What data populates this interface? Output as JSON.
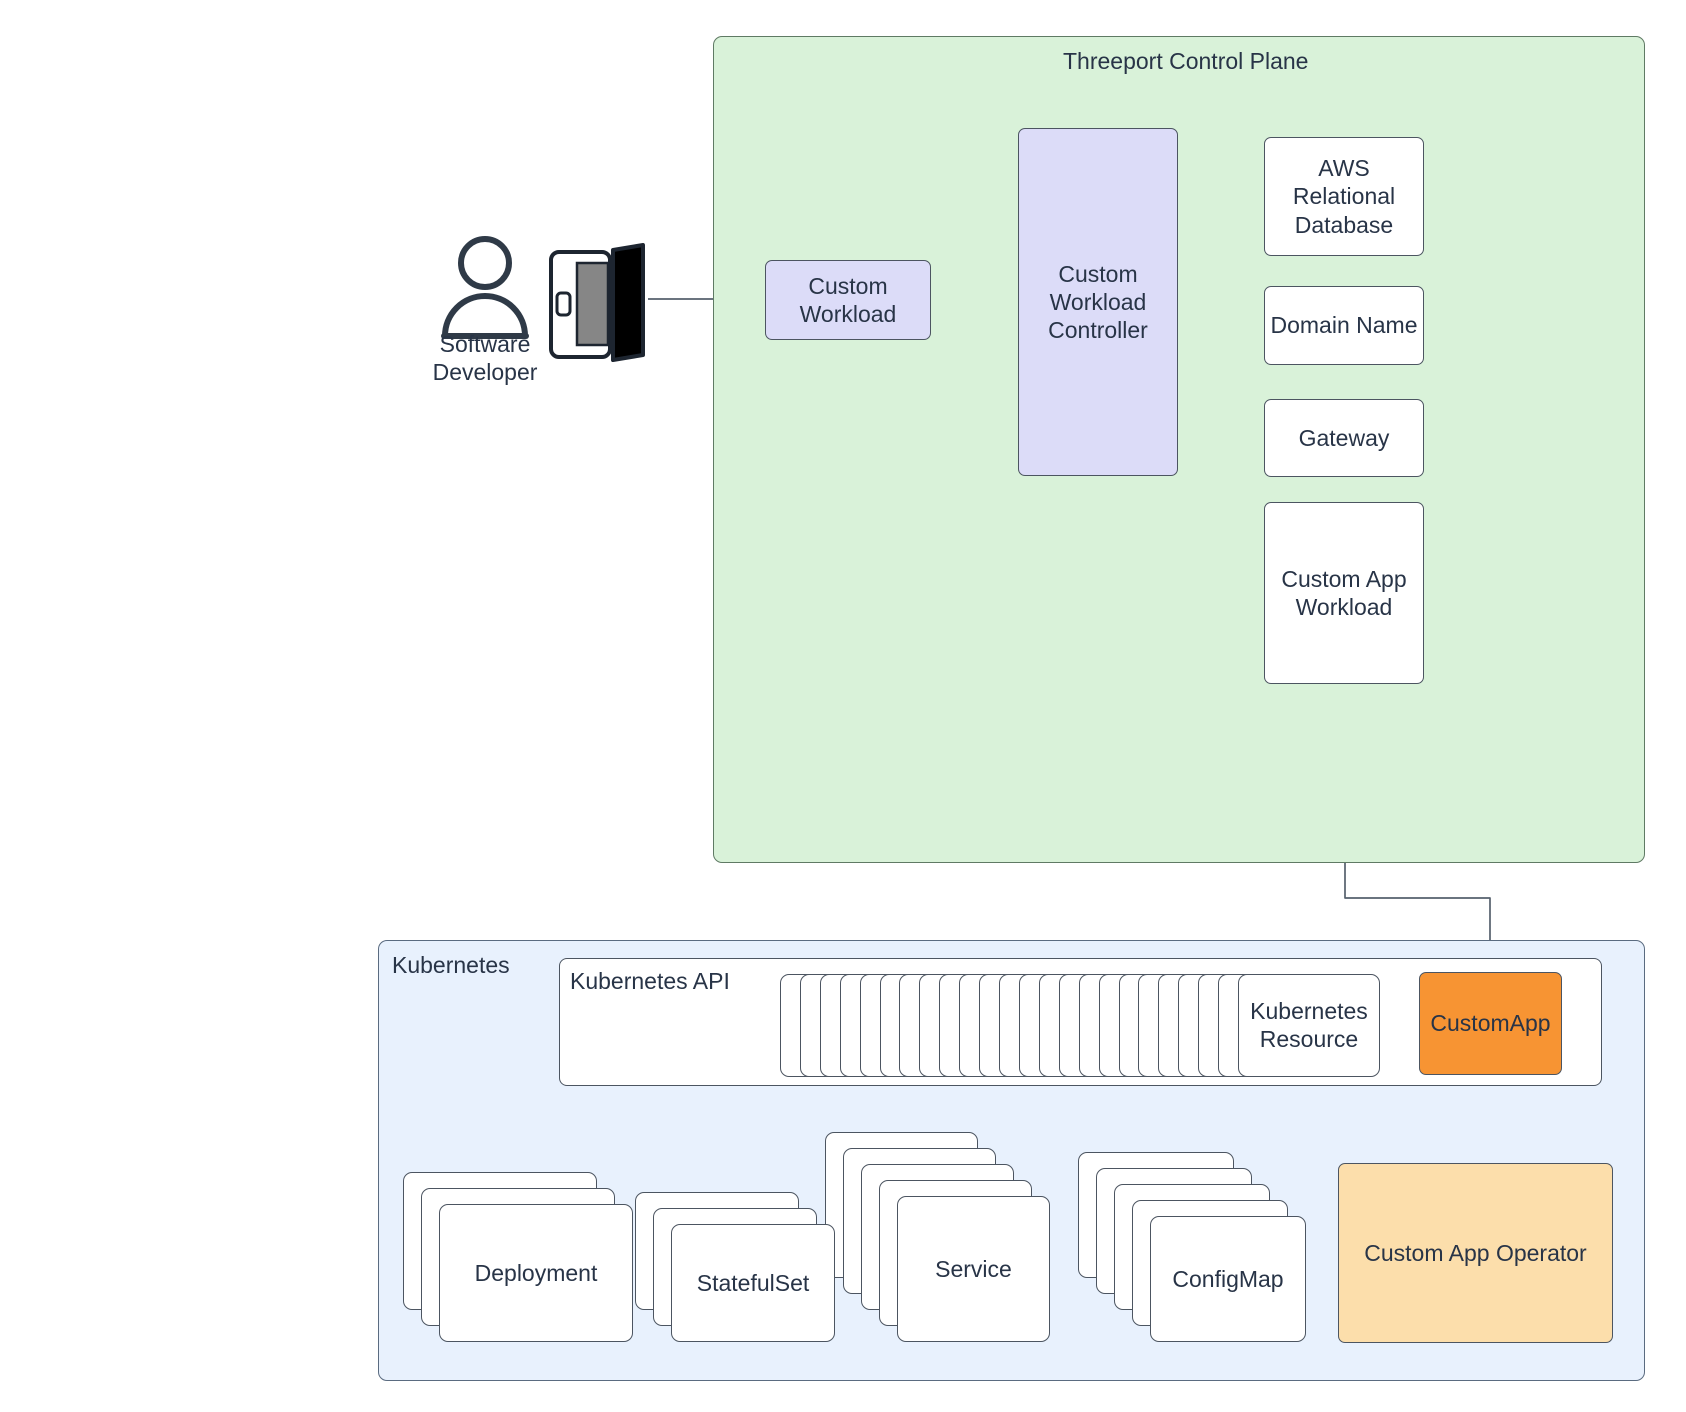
{
  "diagram": {
    "title_control_plane": "Threeport Control Plane",
    "title_kubernetes": "Kubernetes",
    "title_kubernetes_api": "Kubernetes API"
  },
  "actor": {
    "label_line1": "Software",
    "label_line2": "Developer",
    "person_icon": "user-person-icon",
    "laptop_icon": "laptop-icon"
  },
  "control_plane": {
    "custom_workload": "Custom\nWorkload",
    "custom_workload_line1": "Custom",
    "custom_workload_line2": "Workload",
    "custom_workload_controller_line1": "Custom",
    "custom_workload_controller_line2": "Workload",
    "custom_workload_controller_line3": "Controller",
    "aws_rds_line1": "AWS",
    "aws_rds_line2": "Relational",
    "aws_rds_line3": "Database",
    "domain_name": "Domain Name",
    "gateway": "Gateway",
    "custom_app_workload_line1": "Custom App",
    "custom_app_workload_line2": "Workload"
  },
  "kubernetes": {
    "kubernetes_resource_line1": "Kubernetes",
    "kubernetes_resource_line2": "Resource",
    "custom_app": "CustomApp",
    "custom_app_operator": "Custom App Operator",
    "resources": [
      {
        "label": "Deployment",
        "stack": 3
      },
      {
        "label": "StatefulSet",
        "stack": 3
      },
      {
        "label": "Service",
        "stack": 5
      },
      {
        "label": "ConfigMap",
        "stack": 5
      }
    ],
    "kubernetes_resource_stack": 24
  },
  "colors": {
    "control_plane_fill": "#d9f2d9",
    "kubernetes_fill": "#e8f1fd",
    "controller_fill": "#dcdcf8",
    "custom_app_fill": "#f79433",
    "operator_fill": "#fcdeab",
    "node_stroke": "#4c5561",
    "text": "#283447"
  }
}
